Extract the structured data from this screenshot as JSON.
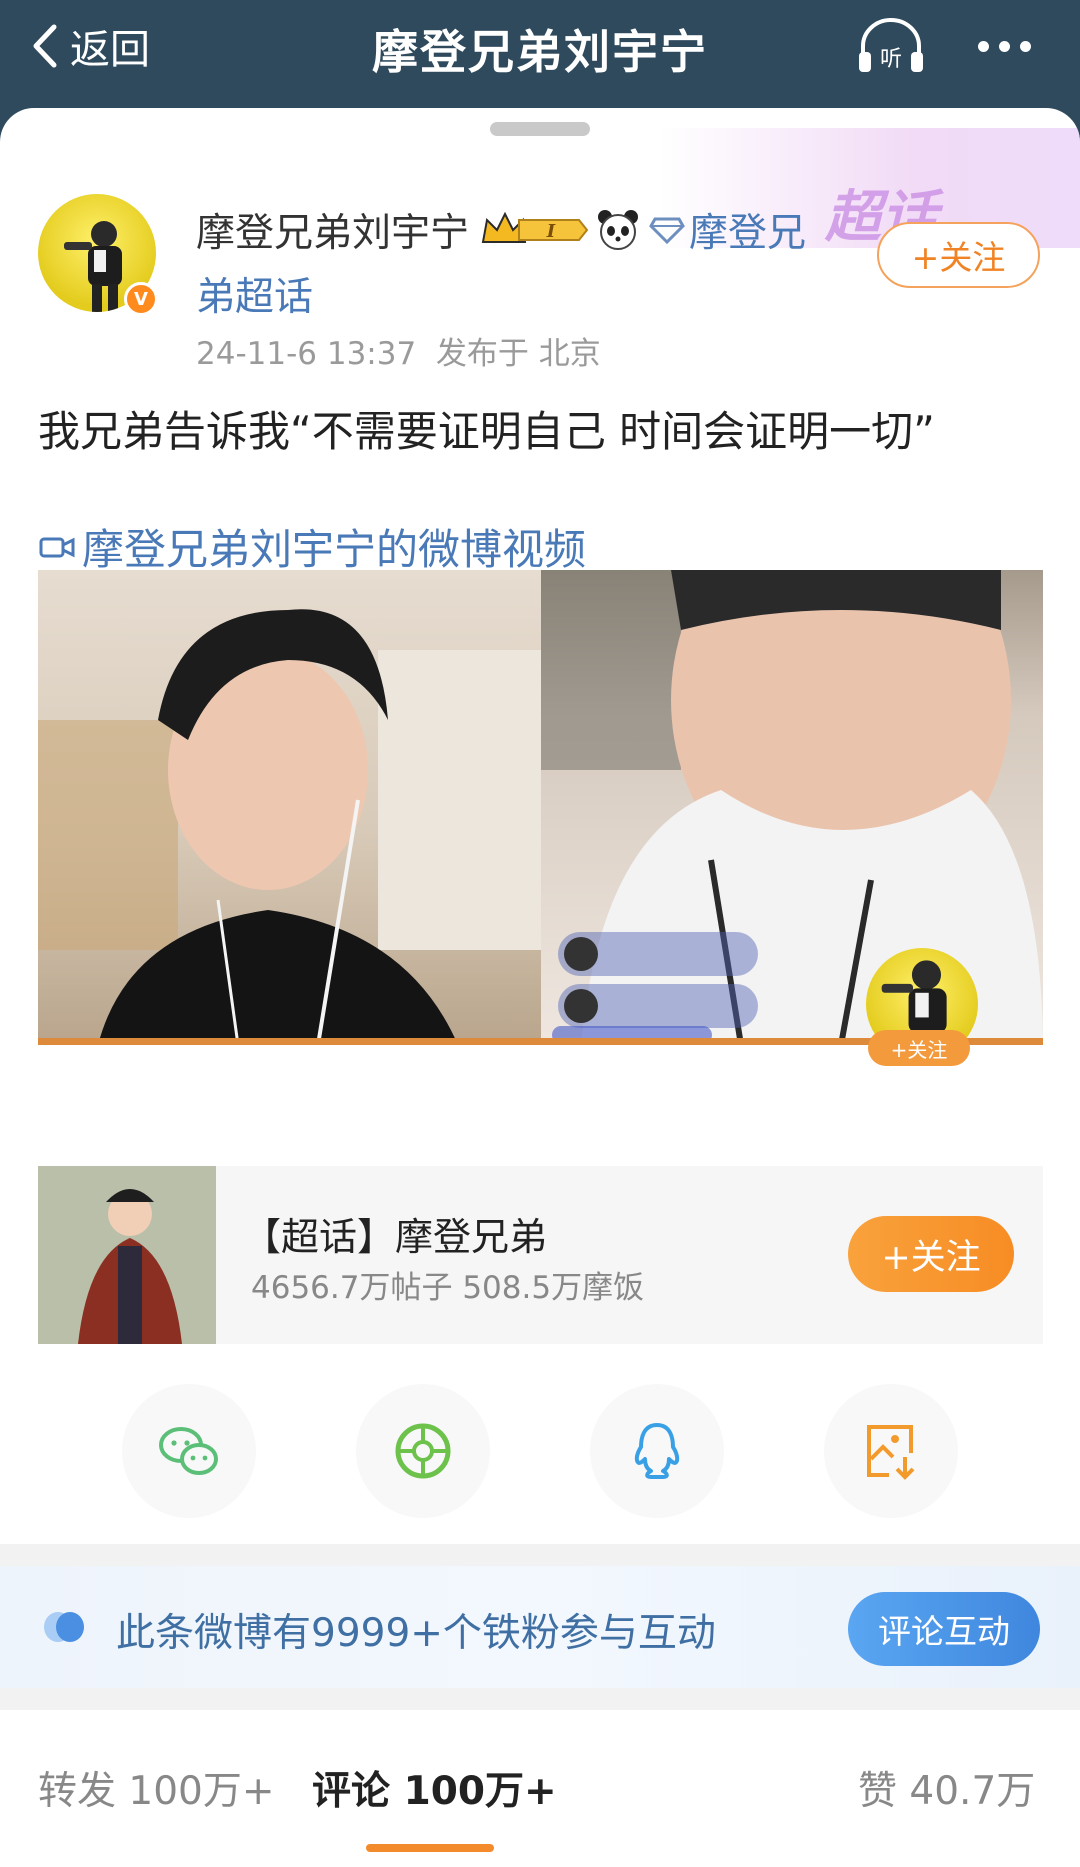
{
  "nav": {
    "back_label": "返回",
    "title": "摩登兄弟刘宇宁",
    "listen_label": "听"
  },
  "promo": {
    "text": "超话"
  },
  "post": {
    "author": "摩登兄弟刘宇宁",
    "level_badge": "I",
    "topic_line1": "摩登兄",
    "topic_line2": "弟超话",
    "vip_badge": "V",
    "time": "24-11-6 13:37",
    "location": "发布于 北京",
    "follow_label": "+关注",
    "text": "我兄弟告诉我“不需要证明自己 时间会证明一切”",
    "video_link": "摩登兄弟刘宇宁的微博视频"
  },
  "video": {
    "pip_follow": "+关注"
  },
  "topic_card": {
    "title": "【超话】摩登兄弟",
    "stats": "4656.7万帖子 508.5万摩饭",
    "follow_label": "+关注"
  },
  "share": [
    {
      "icon": "wechat-icon",
      "color": "#5bbf78"
    },
    {
      "icon": "moments-icon",
      "color": "#6cc24a"
    },
    {
      "icon": "qq-icon",
      "color": "#3aa0e6"
    },
    {
      "icon": "save-image-icon",
      "color": "#f39a2c"
    }
  ],
  "fan_banner": {
    "text": "此条微博有9999+个铁粉参与互动",
    "button": "评论互动"
  },
  "tabs": {
    "repost_label": "转发",
    "repost_count": "100万+",
    "comment_label": "评论",
    "comment_count": "100万+",
    "like_label": "赞",
    "like_count": "40.7万"
  },
  "colors": {
    "nav_bg": "#2f4a5c",
    "link": "#4a79b8",
    "accent_orange": "#f78c24",
    "blue_button": "#3f87de"
  }
}
